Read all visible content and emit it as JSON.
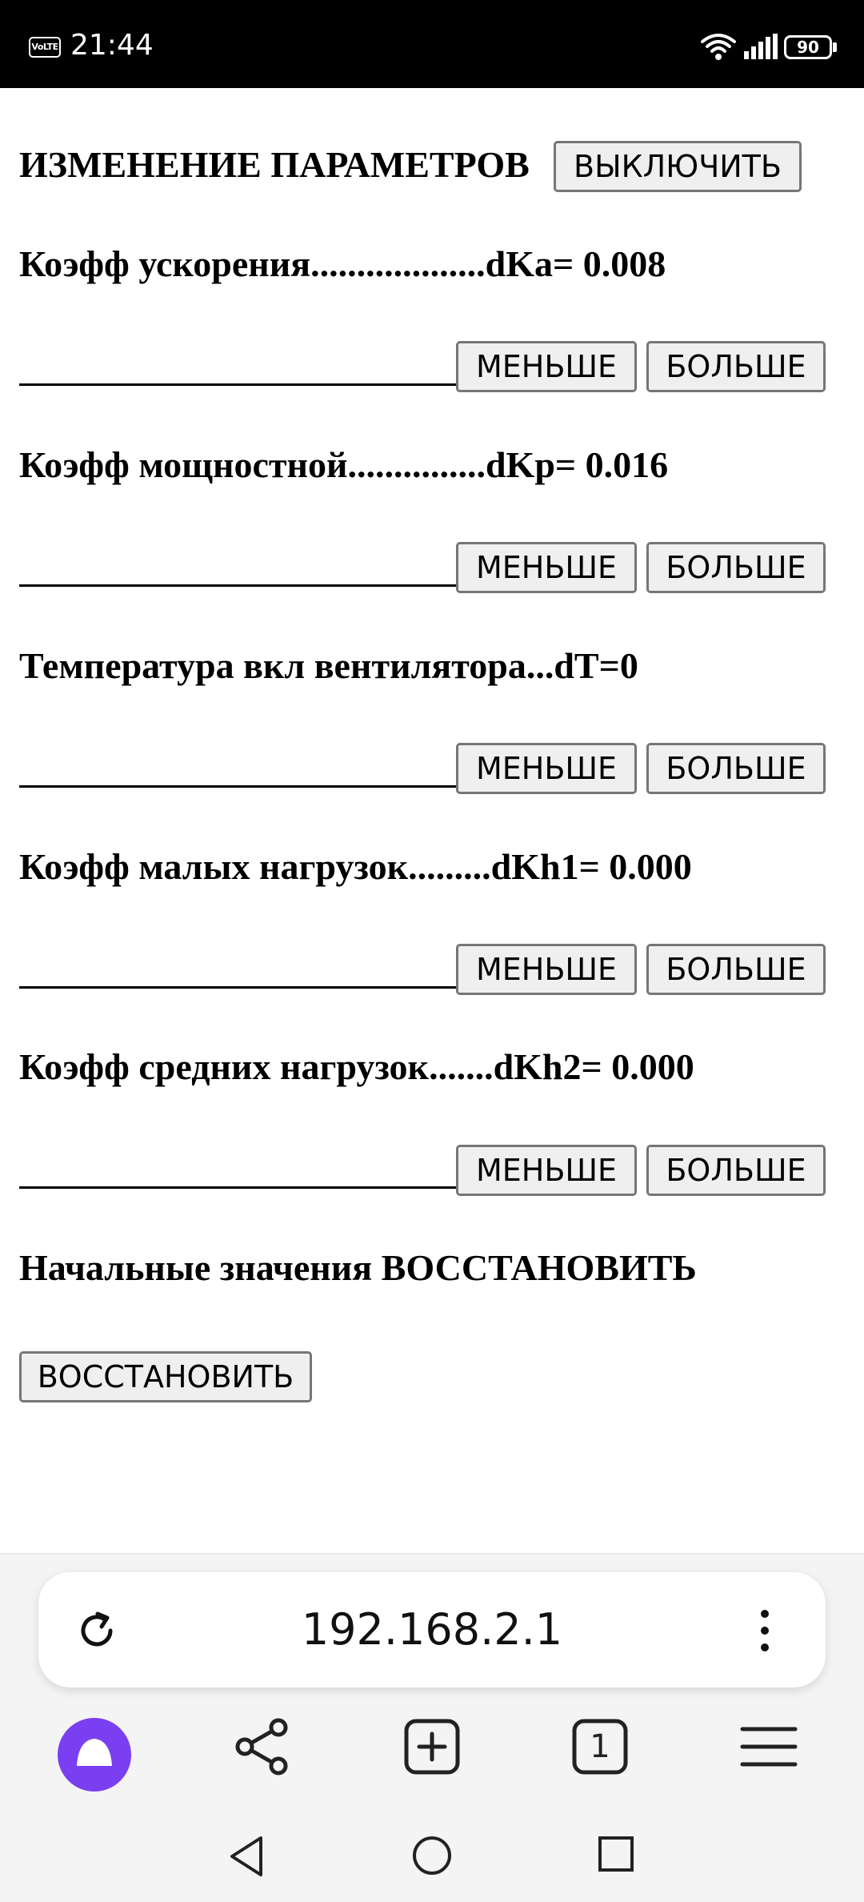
{
  "status_bar": {
    "volte": "VoLTE",
    "time": "21:44",
    "battery": "90"
  },
  "page": {
    "title": "ИЗМЕНЕНИЕ ПАРАМЕТРОВ",
    "off_button": "ВЫКЛЮЧИТЬ",
    "params": [
      {
        "label": "Коэфф ускорения...................dKa= 0.008",
        "less": "МЕНЬШЕ",
        "more": "БОЛЬШЕ"
      },
      {
        "label": "Коэфф мощностной...............dKp= 0.016",
        "less": "МЕНЬШЕ",
        "more": "БОЛЬШЕ"
      },
      {
        "label": "Температура вкл вентилятора...dT=0",
        "less": "МЕНЬШЕ",
        "more": "БОЛЬШЕ"
      },
      {
        "label": "Коэфф малых нагрузок.........dKh1= 0.000",
        "less": "МЕНЬШЕ",
        "more": "БОЛЬШЕ"
      },
      {
        "label": "Коэфф средних нагрузок.......dKh2= 0.000",
        "less": "МЕНЬШЕ",
        "more": "БОЛЬШЕ"
      }
    ],
    "restore_label": "Начальные значения ВОССТАНОВИТЬ",
    "restore_button": "ВОССТАНОВИТЬ"
  },
  "browser": {
    "url": "192.168.2.1",
    "tab_count": "1"
  },
  "colors": {
    "alice_purple": "#7B3FF2"
  }
}
